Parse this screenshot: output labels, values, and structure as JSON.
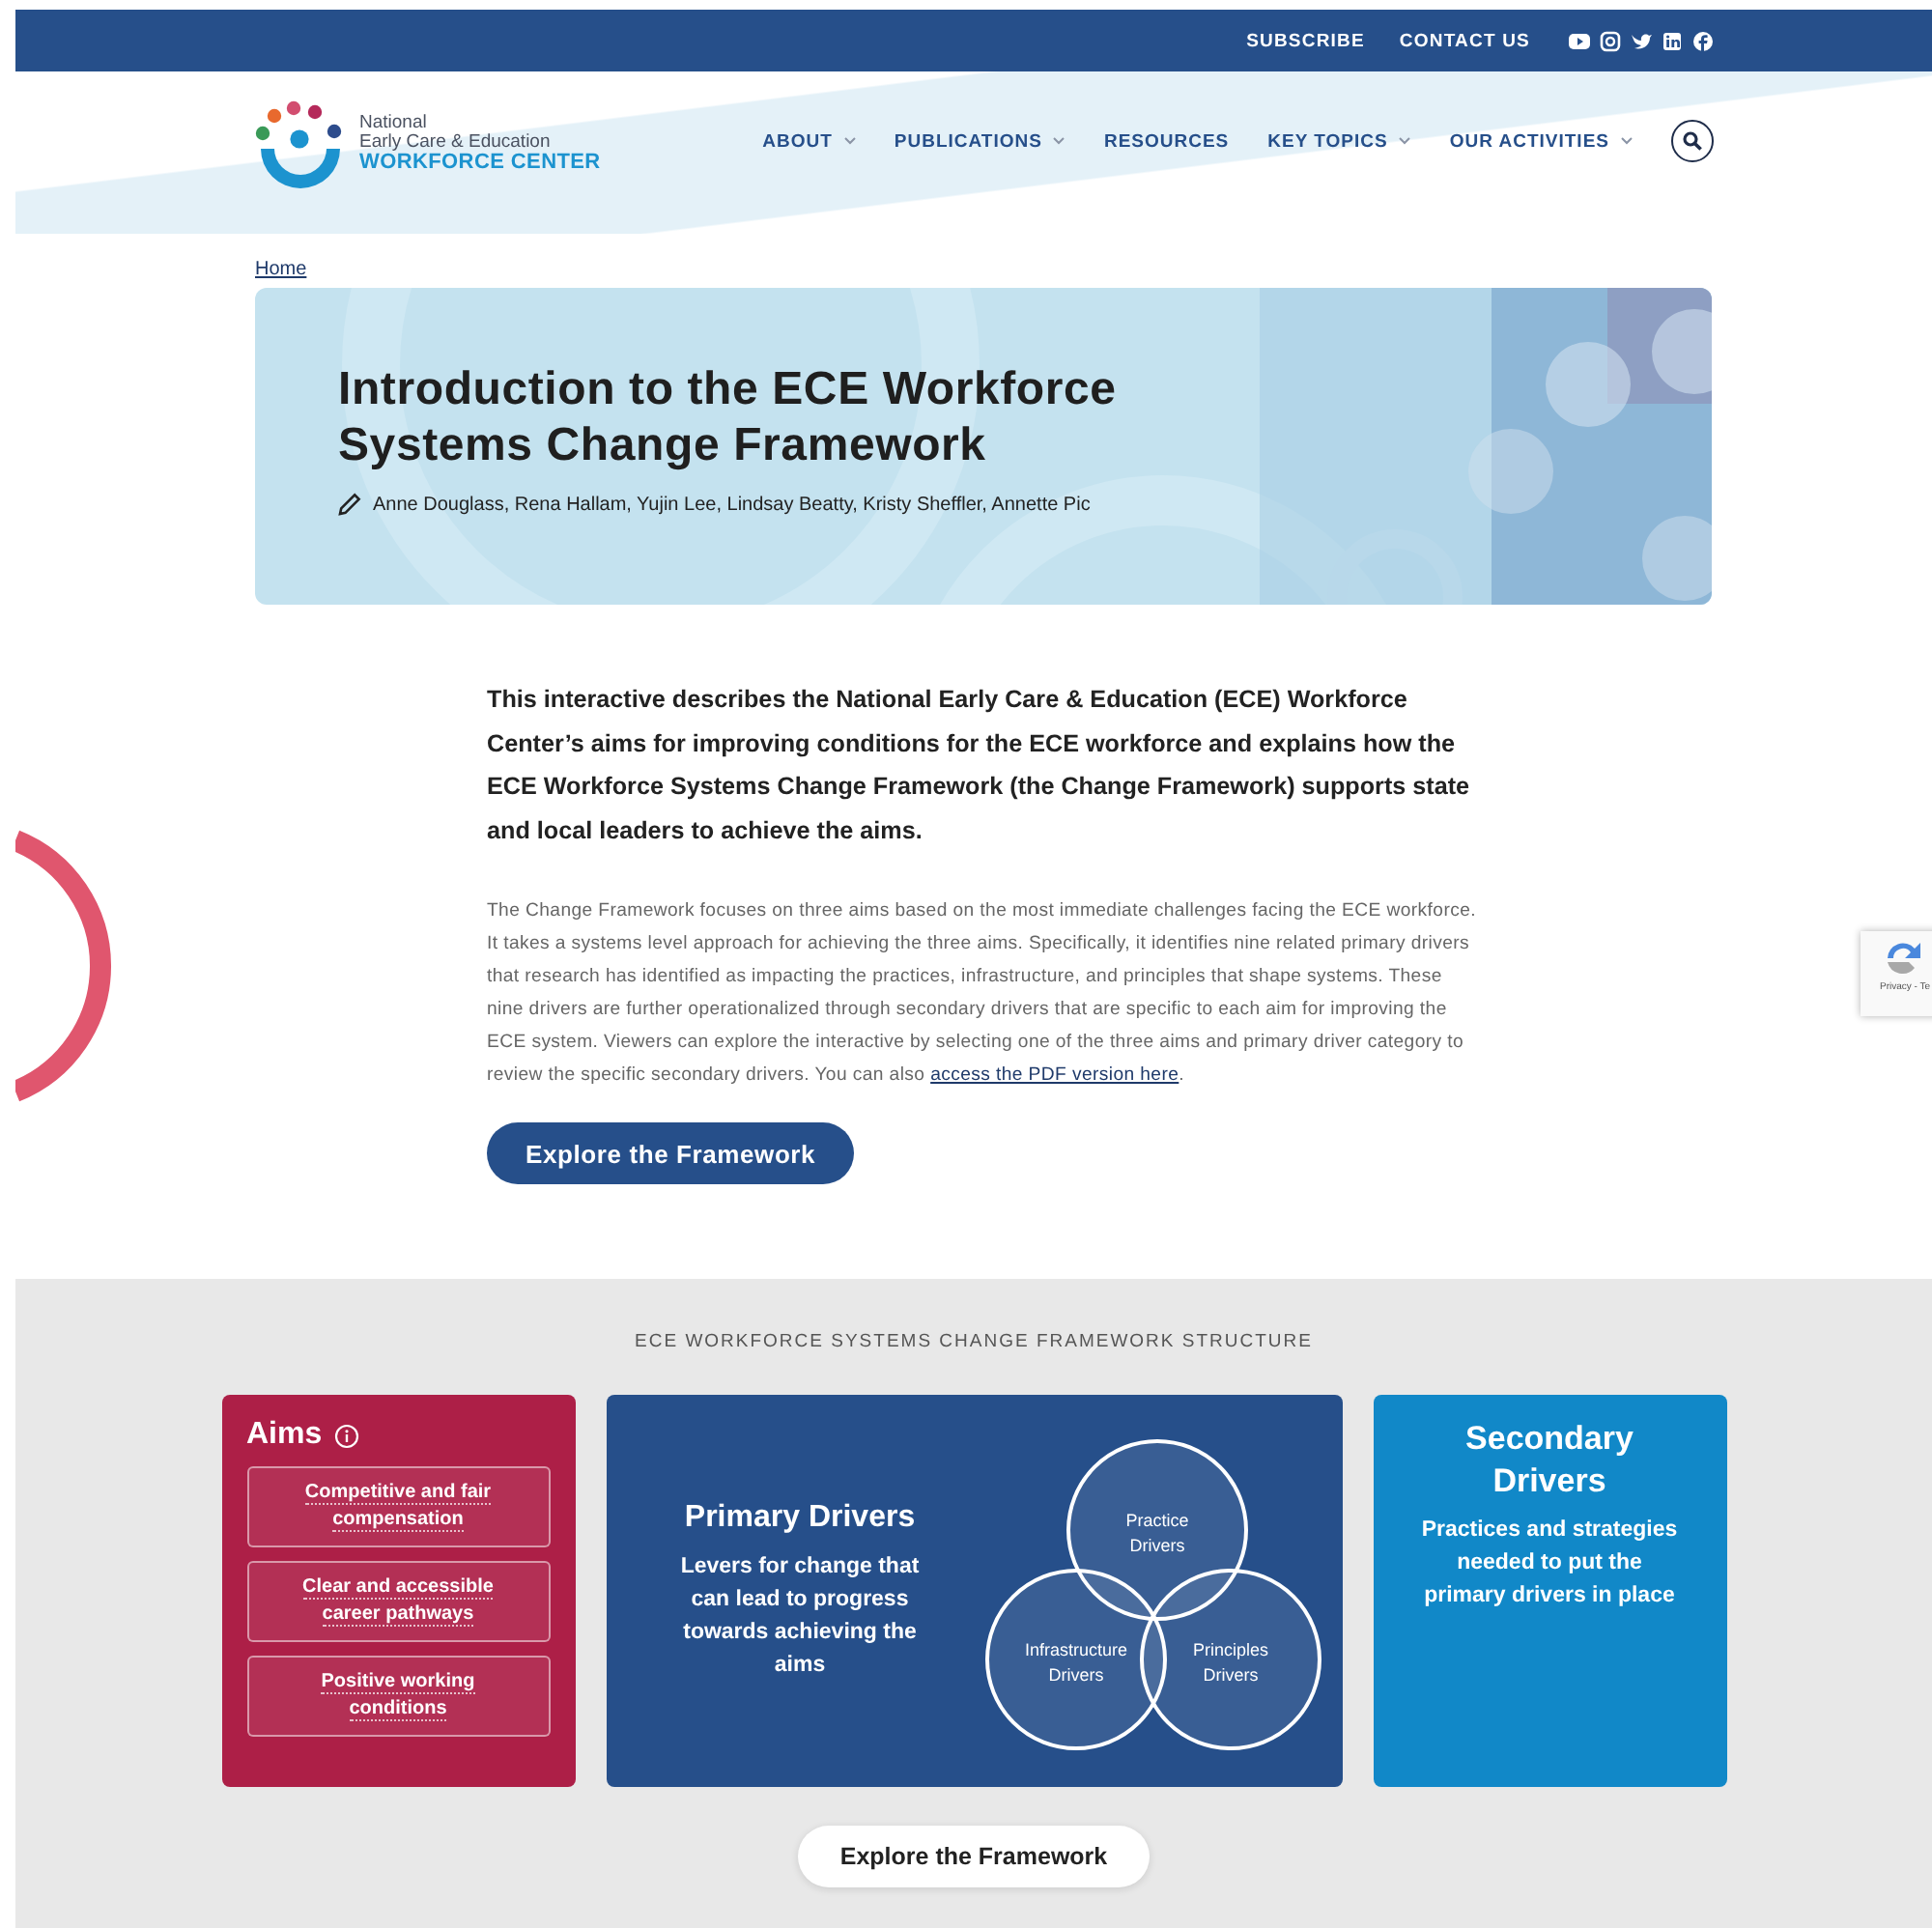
{
  "top_bar": {
    "links": [
      "SUBSCRIBE",
      "CONTACT US"
    ]
  },
  "logo": {
    "line_1": "National",
    "line_2": "Early Care & Education",
    "line_3": "WORKFORCE CENTER"
  },
  "nav": [
    {
      "label": "ABOUT",
      "has_menu": true
    },
    {
      "label": "PUBLICATIONS",
      "has_menu": true
    },
    {
      "label": "RESOURCES",
      "has_menu": false
    },
    {
      "label": "KEY TOPICS",
      "has_menu": true
    },
    {
      "label": "OUR ACTIVITIES",
      "has_menu": true
    }
  ],
  "breadcrumb": "Home",
  "hero": {
    "title": "Introduction to the ECE Workforce Systems Change Framework",
    "authors": "Anne Douglass, Rena Hallam, Yujin Lee, Lindsay Beatty, Kristy Sheffler, Annette Pic"
  },
  "intro": {
    "lead": "This interactive describes the National Early Care & Education (ECE) Workforce Center’s aims for improving conditions for the ECE workforce and explains how the ECE Workforce Systems Change Framework (the Change Framework) supports state and local leaders to achieve the aims.",
    "body": "The Change Framework focuses on three aims based on the most immediate challenges facing the ECE workforce. It takes a systems level approach for achieving the three aims. Specifically, it identifies nine related primary drivers that research has identified as impacting the practices, infrastructure, and principles that shape systems. These nine drivers are further operationalized through secondary drivers that are specific to each aim for improving the ECE system.  Viewers can explore the interactive by selecting one of the three aims and primary driver category to review the specific secondary drivers. You can also",
    "link": "access the PDF version here",
    "body_end": ".",
    "button": "Explore the Framework"
  },
  "framework": {
    "heading": "ECE WORKFORCE SYSTEMS CHANGE FRAMEWORK STRUCTURE",
    "aims": {
      "title": "Aims",
      "items": [
        "Competitive and fair compensation",
        "Clear and accessible career pathways",
        "Positive working conditions"
      ]
    },
    "primary": {
      "title": "Primary Drivers",
      "description": "Levers for change that can lead to progress towards achieving the aims",
      "circles": [
        "Practice Drivers",
        "Infrastructure Drivers",
        "Principles Drivers"
      ]
    },
    "secondary": {
      "title": "Secondary Drivers",
      "description": "Practices and strategies needed to put the primary drivers in place"
    },
    "button": "Explore the Framework"
  },
  "recaptcha": {
    "text": "Privacy - Te"
  }
}
